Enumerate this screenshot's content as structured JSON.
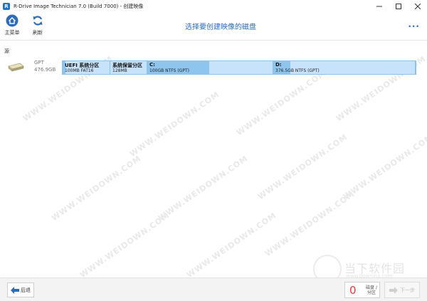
{
  "window": {
    "title": "R-Drive Image Technician 7.0 (Build 7000) - 创建映像",
    "app_icon_letter": "R"
  },
  "toolbar": {
    "home_label": "主菜单",
    "refresh_label": "刷新",
    "page_title": "选择要创建映像的磁盘",
    "more_label": "···"
  },
  "section": {
    "label": "源"
  },
  "disk": {
    "type": "GPT",
    "size": "476.9GB",
    "partitions": [
      {
        "name": "UEFI 系统分区",
        "info": "100MB FAT16",
        "width_frac": 0.135,
        "used_frac": 0.06
      },
      {
        "name": "系统保留分区",
        "info": "128MB",
        "width_frac": 0.105,
        "used_frac": 0.0
      },
      {
        "name": "C:",
        "info": "100GB NTFS (GPT)",
        "width_frac": 0.356,
        "used_frac": 0.49
      },
      {
        "name": "D:",
        "info": "376.5GB NTFS (GPT)",
        "width_frac": 0.404,
        "used_frac": 0.12
      }
    ]
  },
  "watermark": {
    "text": "WWW.WEIDOWN.COM",
    "brand_name": "当下软件园",
    "brand_url": "www.downxia.com"
  },
  "footer": {
    "back_label": "后退",
    "selected_count": "0",
    "selected_label": "磁盘 / 分区",
    "next_label": "下一步"
  },
  "colors": {
    "accent": "#2d6cb8",
    "partition_bg": "#c7e3fb",
    "partition_used": "#8ec5ee",
    "counter_red": "#e23b3b"
  }
}
